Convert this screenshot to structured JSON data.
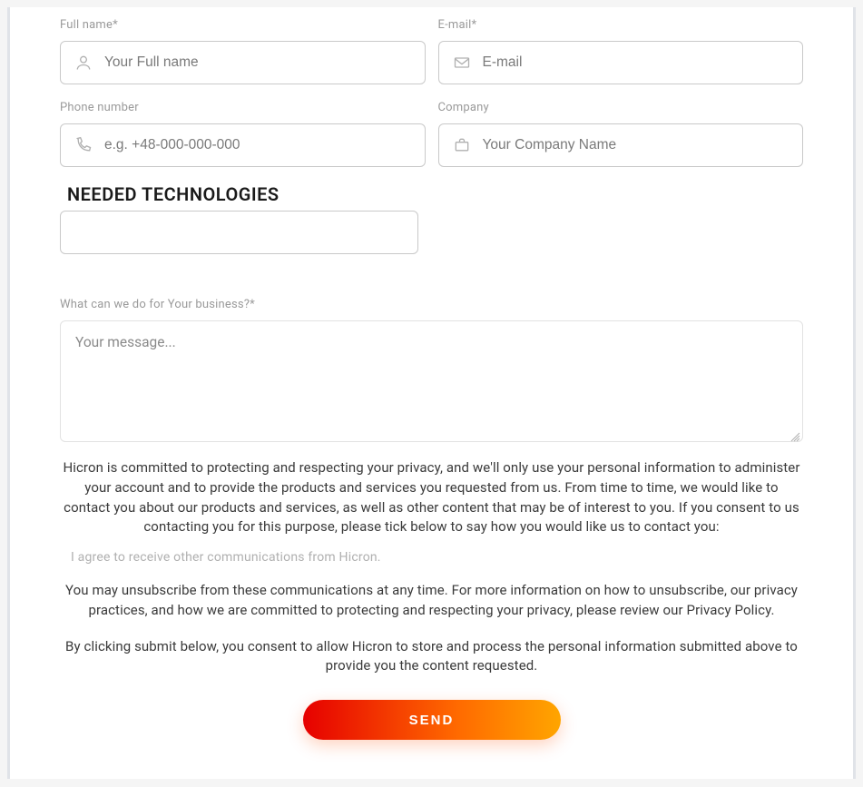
{
  "form": {
    "fullname": {
      "label": "Full name*",
      "placeholder": "Your Full name"
    },
    "email": {
      "label": "E-mail*",
      "placeholder": "E-mail"
    },
    "phone": {
      "label": "Phone number",
      "placeholder": "e.g. +48-000-000-000"
    },
    "company": {
      "label": "Company",
      "placeholder": "Your Company Name"
    },
    "tech": {
      "label": "NEEDED TECHNOLOGIES"
    },
    "message": {
      "label": "What can we do for Your business?*",
      "placeholder": "Your message..."
    }
  },
  "privacy": {
    "p1": "Hicron is committed to protecting and respecting your privacy, and we'll only use your personal information to administer your account and to provide the products and services you requested from us. From time to time, we would like to contact you about our products and services, as well as other content that may be of interest to you. If you consent to us contacting you for this purpose, please tick below to say how you would like us to contact you:",
    "consent": "I agree to receive other communications from Hicron.",
    "p2": "You may unsubscribe from these communications at any time. For more information on how to unsubscribe, our privacy practices, and how we are committed to protecting and respecting your privacy, please review our Privacy Policy.",
    "p3": "By clicking submit below, you consent to allow Hicron to store and process the personal information submitted above to provide you the content requested."
  },
  "actions": {
    "send": "SEND"
  }
}
